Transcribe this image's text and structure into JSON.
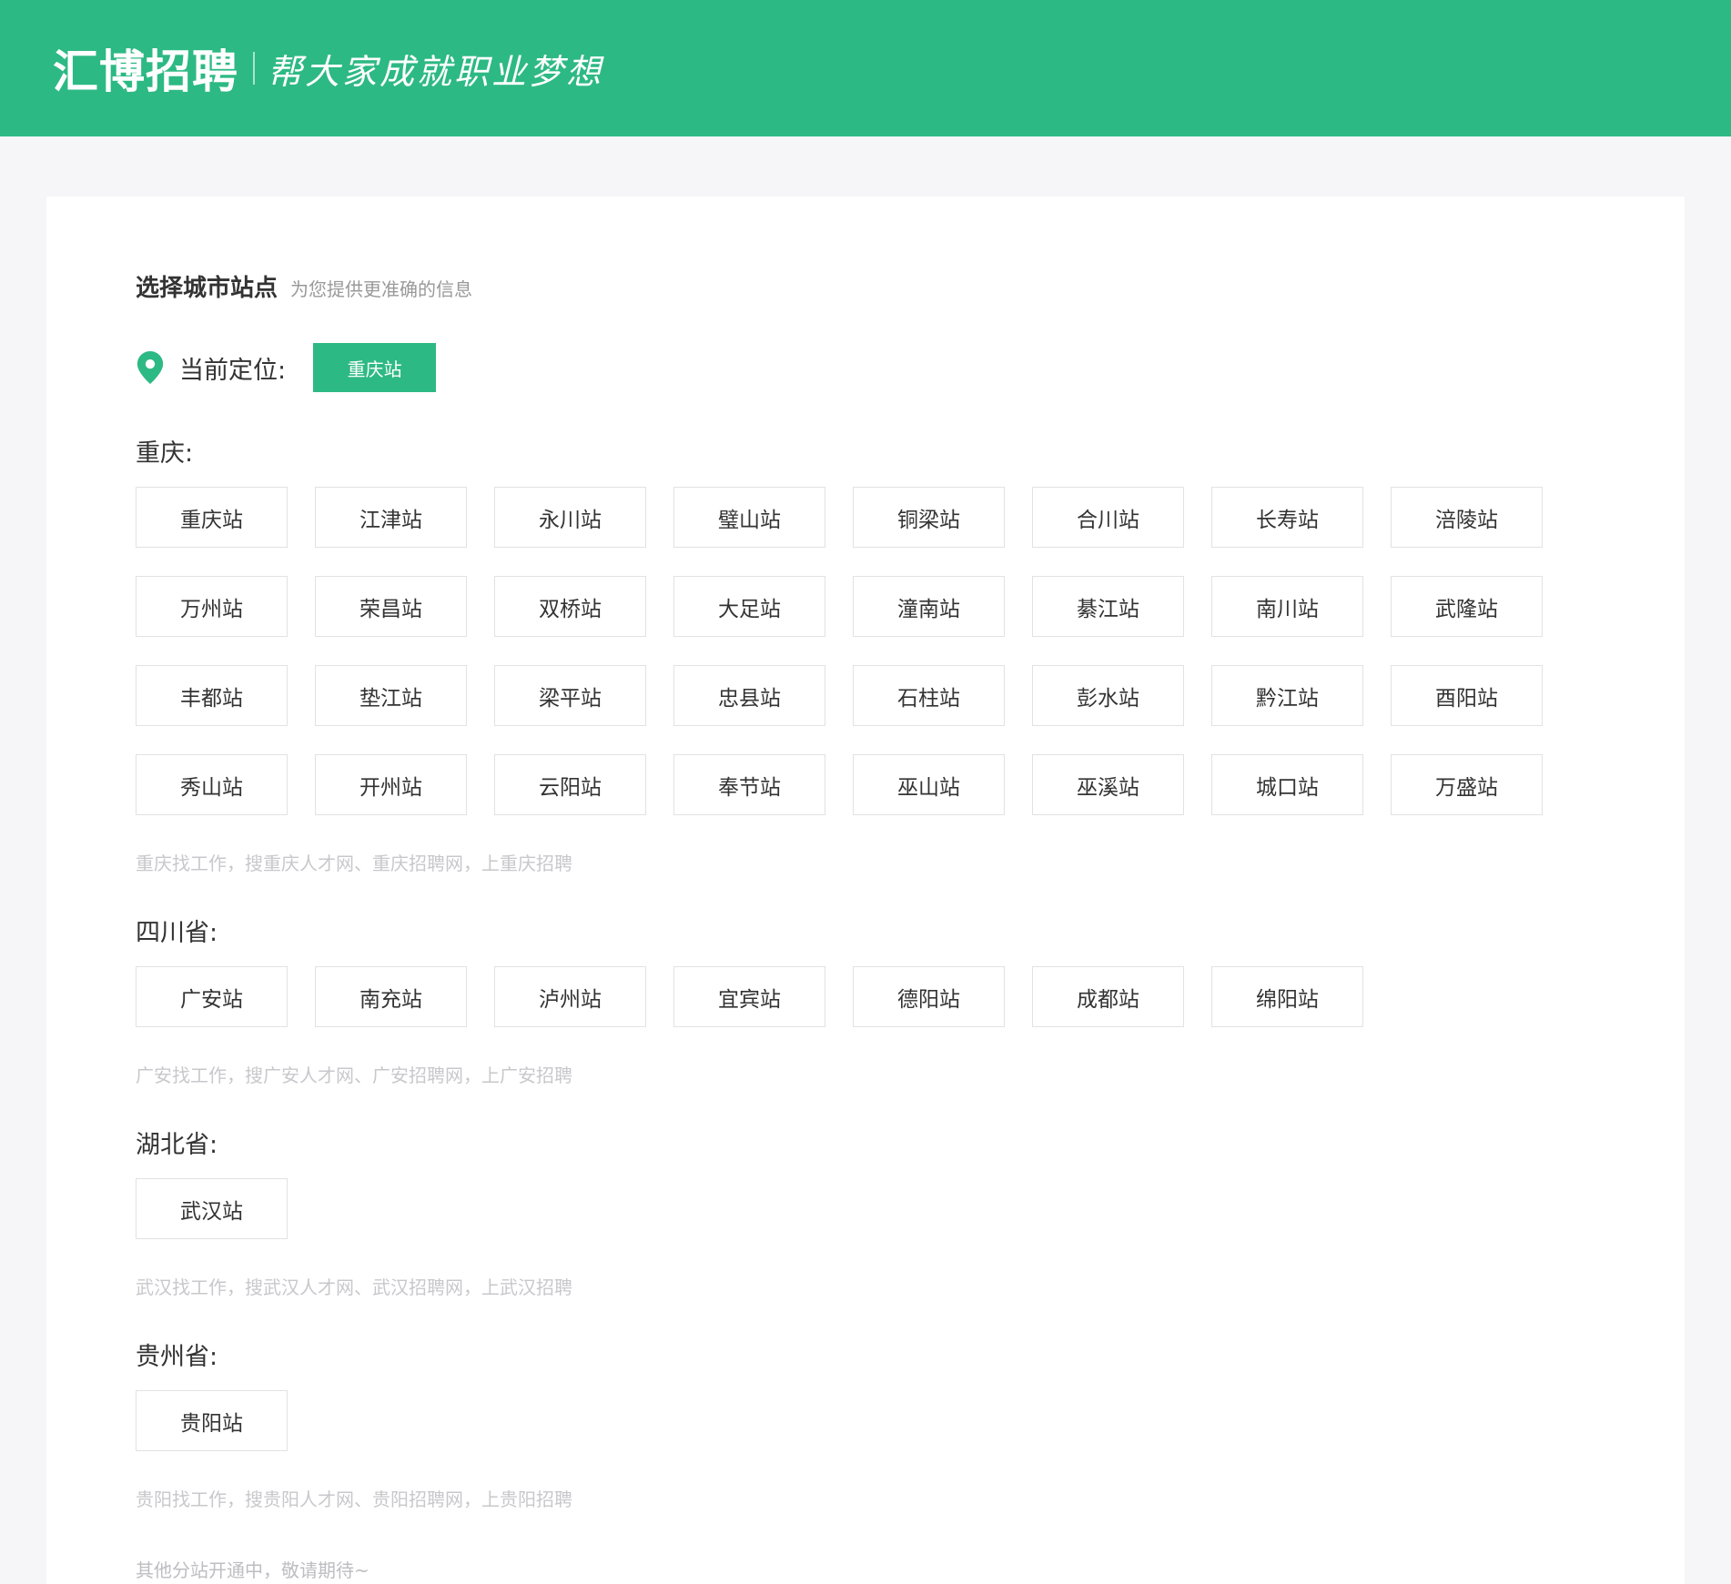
{
  "header": {
    "logo": "汇博招聘",
    "slogan": "帮大家成就职业梦想",
    "bg_color": "#2db984"
  },
  "page": {
    "title": "选择城市站点",
    "subtitle": "为您提供更准确的信息",
    "current_location_label": "当前定位:",
    "current_location_value": "重庆站",
    "footer_note": "其他分站开通中，敬请期待~"
  },
  "regions": [
    {
      "name": "重庆:",
      "stations": [
        "重庆站",
        "江津站",
        "永川站",
        "璧山站",
        "铜梁站",
        "合川站",
        "长寿站",
        "涪陵站",
        "万州站",
        "荣昌站",
        "双桥站",
        "大足站",
        "潼南站",
        "綦江站",
        "南川站",
        "武隆站",
        "丰都站",
        "垫江站",
        "梁平站",
        "忠县站",
        "石柱站",
        "彭水站",
        "黔江站",
        "酉阳站",
        "秀山站",
        "开州站",
        "云阳站",
        "奉节站",
        "巫山站",
        "巫溪站",
        "城口站",
        "万盛站"
      ],
      "hint": "重庆找工作，搜重庆人才网、重庆招聘网，上重庆招聘"
    },
    {
      "name": "四川省:",
      "stations": [
        "广安站",
        "南充站",
        "泸州站",
        "宜宾站",
        "德阳站",
        "成都站",
        "绵阳站"
      ],
      "hint": "广安找工作，搜广安人才网、广安招聘网，上广安招聘"
    },
    {
      "name": "湖北省:",
      "stations": [
        "武汉站"
      ],
      "hint": "武汉找工作，搜武汉人才网、武汉招聘网，上武汉招聘"
    },
    {
      "name": "贵州省:",
      "stations": [
        "贵阳站"
      ],
      "hint": "贵阳找工作，搜贵阳人才网、贵阳招聘网，上贵阳招聘"
    }
  ]
}
